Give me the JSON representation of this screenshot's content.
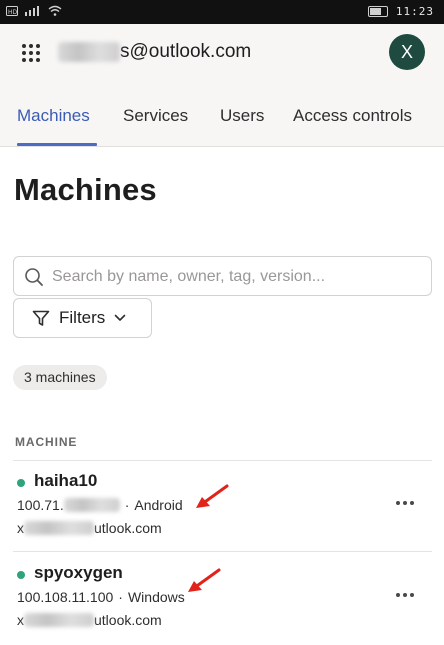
{
  "status_bar": {
    "left_icons": [
      "hd-icon",
      "signal-icon",
      "wifi-icon"
    ],
    "time": "11:23"
  },
  "header": {
    "account_suffix": "s@outlook.com",
    "avatar_initial": "X"
  },
  "tabs": [
    {
      "label": "Machines",
      "active": true
    },
    {
      "label": "Services",
      "active": false
    },
    {
      "label": "Users",
      "active": false
    },
    {
      "label": "Access controls",
      "active": false
    }
  ],
  "page": {
    "title": "Machines",
    "search_placeholder": "Search by name, owner, tag, version...",
    "filters_label": "Filters",
    "count_label": "3 machines",
    "column_header": "MACHINE"
  },
  "machines": [
    {
      "name": "haiha10",
      "address_prefix": "100.71.",
      "address_suffix": "·",
      "os": "Android",
      "owner_prefix": "x",
      "owner_suffix": "utlook.com",
      "status": "online"
    },
    {
      "name": "spyoxygen",
      "address_prefix": "100.108.11.100",
      "address_suffix": "·",
      "os": "Windows",
      "owner_prefix": "x",
      "owner_suffix": "utlook.com",
      "status": "online"
    }
  ],
  "colors": {
    "accent": "#3b5bb5",
    "online": "#2ea37c",
    "avatar": "#1e4a3f",
    "annotation_arrow": "#e0231b"
  }
}
